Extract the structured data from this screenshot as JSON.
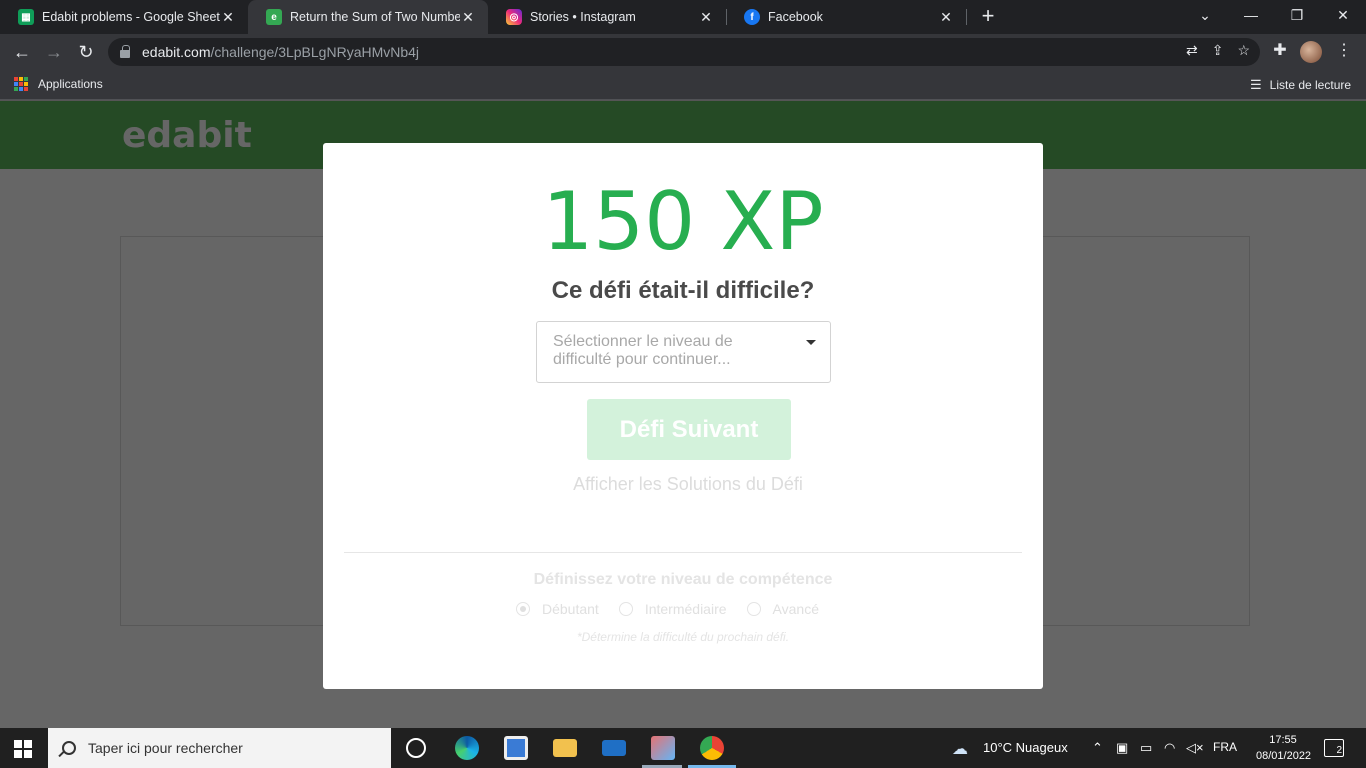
{
  "tabs": [
    {
      "title": "Edabit problems - Google Sheets",
      "icon": "google-sheets-icon",
      "color": "#0f9d58"
    },
    {
      "title": "Return the Sum of Two Numbers",
      "icon": "edabit-icon",
      "color": "#34a853"
    },
    {
      "title": "Stories • Instagram",
      "icon": "instagram-icon",
      "color": "#e1306c"
    },
    {
      "title": "Facebook",
      "icon": "facebook-icon",
      "color": "#1877f2"
    }
  ],
  "address": {
    "host": "edabit.com",
    "path": "/challenge/3LpBLgNRyaHMvNb4j"
  },
  "bookmarks": {
    "apps": "Applications",
    "reading_list": "Liste de lecture"
  },
  "site": {
    "logo": "edabit"
  },
  "modal": {
    "xp": "150 XP",
    "question": "Ce défi était-il difficile?",
    "select_placeholder": "Sélectionner le niveau de difficulté pour continuer...",
    "next_button": "Défi Suivant",
    "solutions_link": "Afficher les Solutions du Défi",
    "skill_title": "Définissez votre niveau de compétence",
    "levels": [
      "Débutant",
      "Intermédiaire",
      "Avancé"
    ],
    "selected_level": "Débutant",
    "note": "*Détermine la difficulté du prochain défi."
  },
  "taskbar": {
    "search_placeholder": "Taper ici pour rechercher",
    "weather": "10°C  Nuageux",
    "language": "FRA",
    "time": "17:55",
    "date": "08/01/2022",
    "notifications": "2"
  },
  "colors": {
    "accent": "#27ae50",
    "button_disabled": "#d3f2db"
  }
}
